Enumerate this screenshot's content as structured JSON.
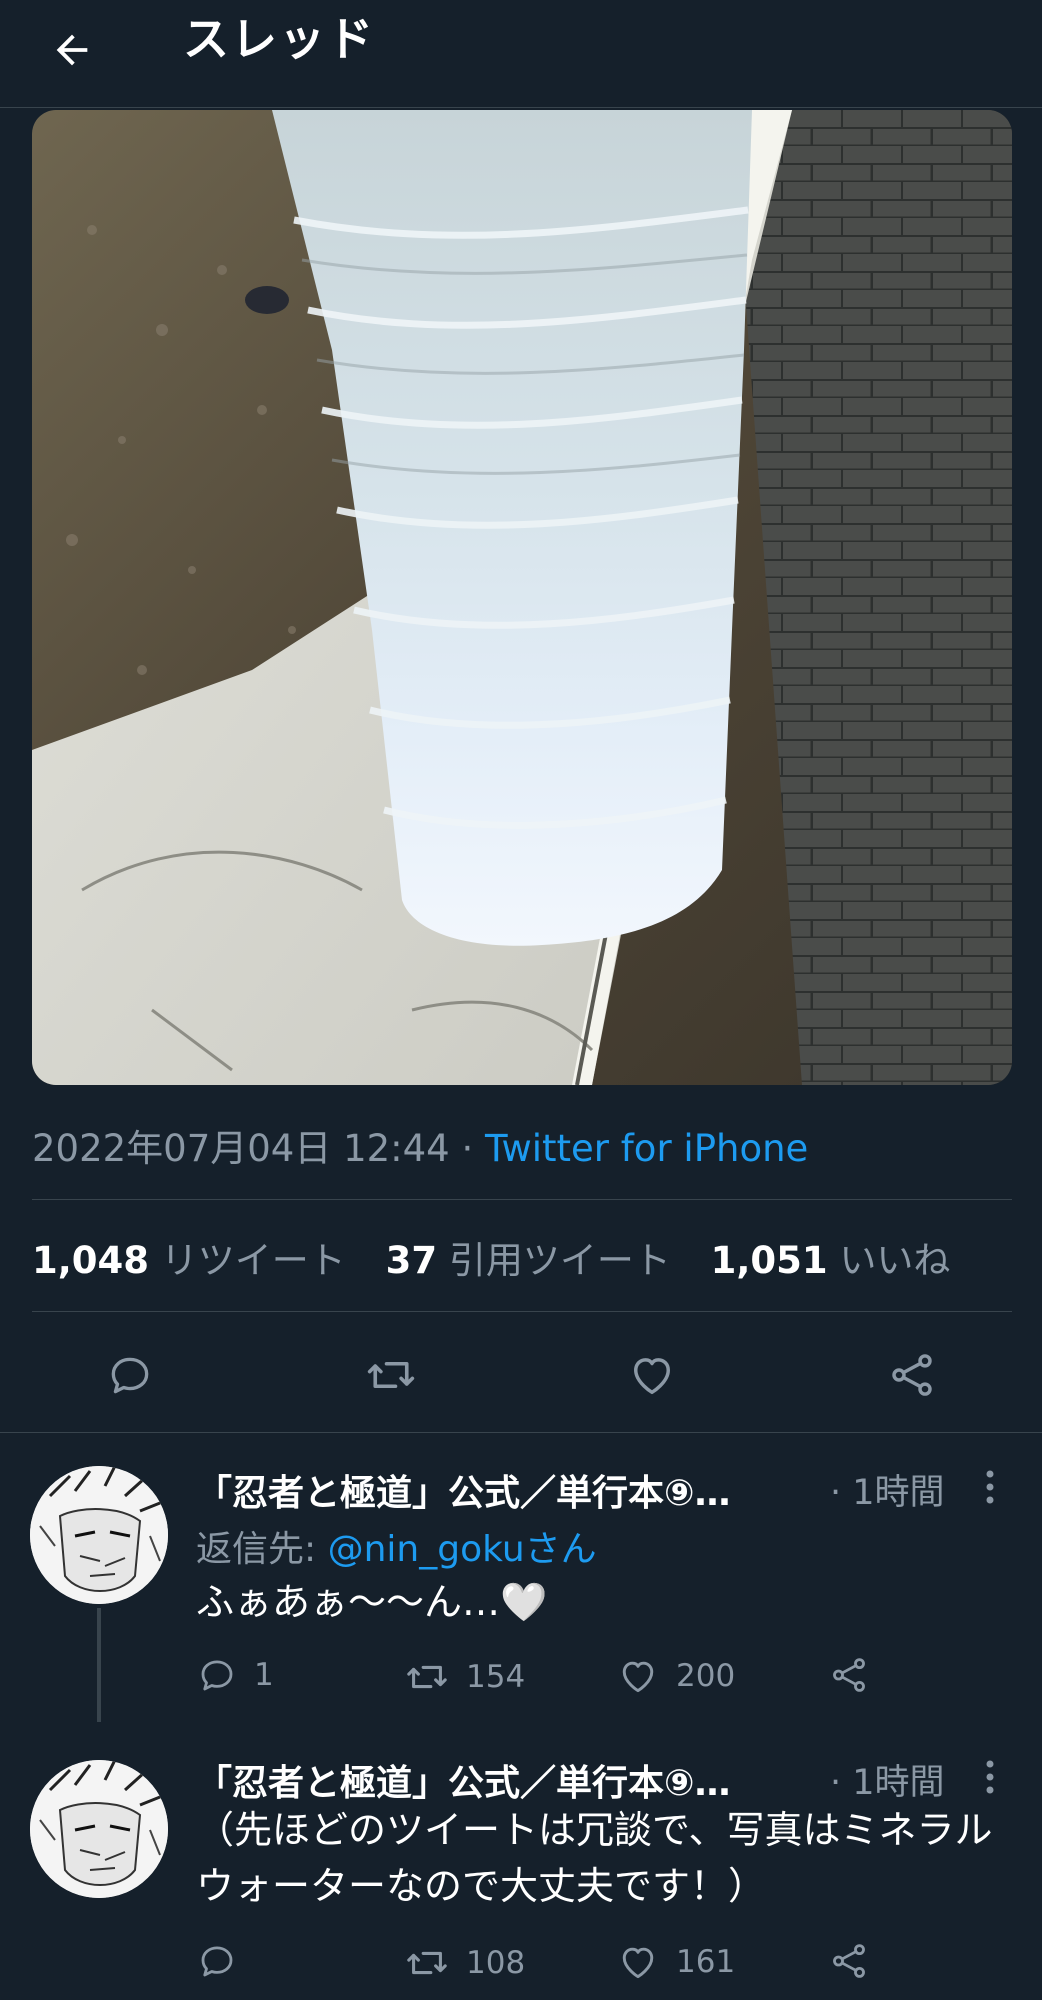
{
  "header": {
    "title": "スレッド"
  },
  "tweet": {
    "timestamp": "2022年07月04日 12:44",
    "separator": "·",
    "source": "Twitter for iPhone",
    "retweets": {
      "count": "1,048",
      "label": "リツイート"
    },
    "quotes": {
      "count": "37",
      "label": "引用ツイート"
    },
    "likes": {
      "count": "1,051",
      "label": "いいね"
    }
  },
  "replies": [
    {
      "author": "「忍者と極道」公式／単行本⑨…",
      "time": "· 1時間",
      "replying_prefix": "返信先: ",
      "replying_handle": "@nin_gokuさん",
      "text": "ふぁあぁ〜〜ん…🤍",
      "reply_count": "1",
      "retweet_count": "154",
      "like_count": "200"
    },
    {
      "author": "「忍者と極道」公式／単行本⑨…",
      "time": "· 1時間",
      "text": "（先ほどのツイートは冗談で、写真はミネラルウォーターなので大丈夫です！）",
      "reply_count": "",
      "retweet_count": "108",
      "like_count": "161"
    }
  ],
  "colors": {
    "background": "#15202b",
    "accent": "#1d9bf0",
    "muted": "#8b98a5",
    "border": "#38444d"
  }
}
